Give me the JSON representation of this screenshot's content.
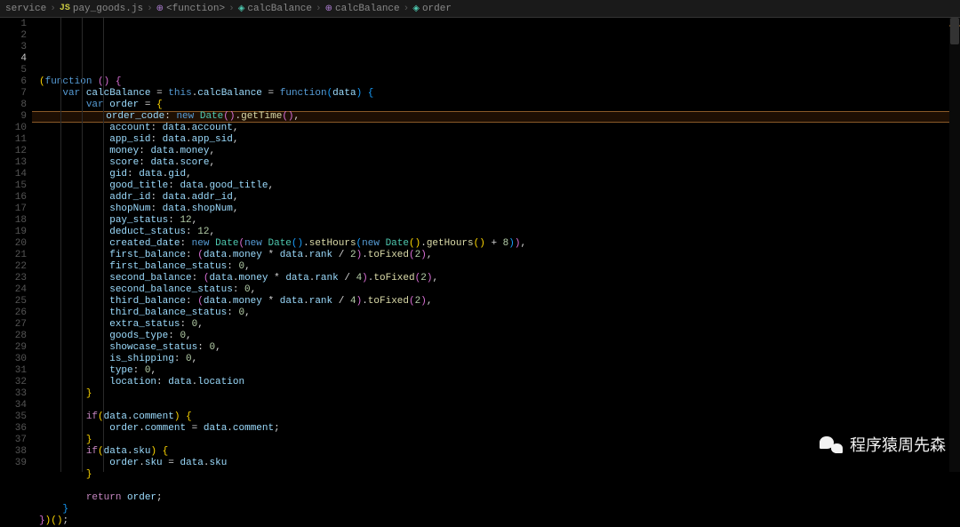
{
  "breadcrumb": {
    "items": [
      {
        "label": "service",
        "icon": ""
      },
      {
        "label": "pay_goods.js",
        "icon": "JS"
      },
      {
        "label": "<function>",
        "icon": "fn"
      },
      {
        "label": "calcBalance",
        "icon": "fld"
      },
      {
        "label": "calcBalance",
        "icon": "fn"
      },
      {
        "label": "order",
        "icon": "fld"
      }
    ]
  },
  "highlighted_line": 4,
  "code_lines": [
    {
      "n": 1,
      "html": "<span class='tk-br'>(</span><span class='tk-kw'>function</span> <span class='tk-br2'>(</span><span class='tk-br2'>)</span> <span class='tk-br2'>{</span>"
    },
    {
      "n": 2,
      "html": "    <span class='tk-kw'>var</span> <span class='tk-var'>calcBalance</span> <span class='tk-op'>=</span> <span class='tk-kw'>this</span>.<span class='tk-var'>calcBalance</span> <span class='tk-op'>=</span> <span class='tk-kw'>function</span><span class='tk-br3'>(</span><span class='tk-var'>data</span><span class='tk-br3'>)</span> <span class='tk-br3'>{</span>"
    },
    {
      "n": 3,
      "html": "        <span class='tk-kw'>var</span> <span class='tk-var'>order</span> <span class='tk-op'>=</span> <span class='tk-br'>{</span>"
    },
    {
      "n": 4,
      "html": "            <span class='tk-prop'>order_code</span>: <span class='tk-kw'>new</span> <span class='tk-cls'>Date</span><span class='tk-br2'>(</span><span class='tk-br2'>)</span>.<span class='tk-fn'>getTime</span><span class='tk-br2'>(</span><span class='tk-br2'>)</span>,"
    },
    {
      "n": 5,
      "html": "            <span class='tk-prop'>account</span>: <span class='tk-var'>data</span>.<span class='tk-var'>account</span>,"
    },
    {
      "n": 6,
      "html": "            <span class='tk-prop'>app_sid</span>: <span class='tk-var'>data</span>.<span class='tk-var'>app_sid</span>,"
    },
    {
      "n": 7,
      "html": "            <span class='tk-prop'>money</span>: <span class='tk-var'>data</span>.<span class='tk-var'>money</span>,"
    },
    {
      "n": 8,
      "html": "            <span class='tk-prop'>score</span>: <span class='tk-var'>data</span>.<span class='tk-var'>score</span>,"
    },
    {
      "n": 9,
      "html": "            <span class='tk-prop'>gid</span>: <span class='tk-var'>data</span>.<span class='tk-var'>gid</span>,"
    },
    {
      "n": 10,
      "html": "            <span class='tk-prop'>good_title</span>: <span class='tk-var'>data</span>.<span class='tk-var'>good_title</span>,"
    },
    {
      "n": 11,
      "html": "            <span class='tk-prop'>addr_id</span>: <span class='tk-var'>data</span>.<span class='tk-var'>addr_id</span>,"
    },
    {
      "n": 12,
      "html": "            <span class='tk-prop'>shopNum</span>: <span class='tk-var'>data</span>.<span class='tk-var'>shopNum</span>,"
    },
    {
      "n": 13,
      "html": "            <span class='tk-prop'>pay_status</span>: <span class='tk-num'>12</span>,"
    },
    {
      "n": 14,
      "html": "            <span class='tk-prop'>deduct_status</span>: <span class='tk-num'>12</span>,"
    },
    {
      "n": 15,
      "html": "            <span class='tk-prop'>created_date</span>: <span class='tk-kw'>new</span> <span class='tk-cls'>Date</span><span class='tk-br2'>(</span><span class='tk-kw'>new</span> <span class='tk-cls'>Date</span><span class='tk-br3'>(</span><span class='tk-br3'>)</span>.<span class='tk-fn'>setHours</span><span class='tk-br3'>(</span><span class='tk-kw'>new</span> <span class='tk-cls'>Date</span><span class='tk-br'>(</span><span class='tk-br'>)</span>.<span class='tk-fn'>getHours</span><span class='tk-br'>(</span><span class='tk-br'>)</span> <span class='tk-op'>+</span> <span class='tk-num'>8</span><span class='tk-br3'>)</span><span class='tk-br2'>)</span>,"
    },
    {
      "n": 16,
      "html": "            <span class='tk-prop'>first_balance</span>: <span class='tk-br2'>(</span><span class='tk-var'>data</span>.<span class='tk-var'>money</span> <span class='tk-op'>*</span> <span class='tk-var'>data</span>.<span class='tk-var'>rank</span> <span class='tk-op'>/</span> <span class='tk-num'>2</span><span class='tk-br2'>)</span>.<span class='tk-fn'>toFixed</span><span class='tk-br2'>(</span><span class='tk-num'>2</span><span class='tk-br2'>)</span>,"
    },
    {
      "n": 17,
      "html": "            <span class='tk-prop'>first_balance_status</span>: <span class='tk-num'>0</span>,"
    },
    {
      "n": 18,
      "html": "            <span class='tk-prop'>second_balance</span>: <span class='tk-br2'>(</span><span class='tk-var'>data</span>.<span class='tk-var'>money</span> <span class='tk-op'>*</span> <span class='tk-var'>data</span>.<span class='tk-var'>rank</span> <span class='tk-op'>/</span> <span class='tk-num'>4</span><span class='tk-br2'>)</span>.<span class='tk-fn'>toFixed</span><span class='tk-br2'>(</span><span class='tk-num'>2</span><span class='tk-br2'>)</span>,"
    },
    {
      "n": 19,
      "html": "            <span class='tk-prop'>second_balance_status</span>: <span class='tk-num'>0</span>,"
    },
    {
      "n": 20,
      "html": "            <span class='tk-prop'>third_balance</span>: <span class='tk-br2'>(</span><span class='tk-var'>data</span>.<span class='tk-var'>money</span> <span class='tk-op'>*</span> <span class='tk-var'>data</span>.<span class='tk-var'>rank</span> <span class='tk-op'>/</span> <span class='tk-num'>4</span><span class='tk-br2'>)</span>.<span class='tk-fn'>toFixed</span><span class='tk-br2'>(</span><span class='tk-num'>2</span><span class='tk-br2'>)</span>,"
    },
    {
      "n": 21,
      "html": "            <span class='tk-prop'>third_balance_status</span>: <span class='tk-num'>0</span>,"
    },
    {
      "n": 22,
      "html": "            <span class='tk-prop'>extra_status</span>: <span class='tk-num'>0</span>,"
    },
    {
      "n": 23,
      "html": "            <span class='tk-prop'>goods_type</span>: <span class='tk-num'>0</span>,"
    },
    {
      "n": 24,
      "html": "            <span class='tk-prop'>showcase_status</span>: <span class='tk-num'>0</span>,"
    },
    {
      "n": 25,
      "html": "            <span class='tk-prop'>is_shipping</span>: <span class='tk-num'>0</span>,"
    },
    {
      "n": 26,
      "html": "            <span class='tk-prop'>type</span>: <span class='tk-num'>0</span>,"
    },
    {
      "n": 27,
      "html": "            <span class='tk-prop'>location</span>: <span class='tk-var'>data</span>.<span class='tk-var'>location</span>"
    },
    {
      "n": 28,
      "html": "        <span class='tk-br'>}</span>"
    },
    {
      "n": 29,
      "html": ""
    },
    {
      "n": 30,
      "html": "        <span class='tk-kw2'>if</span><span class='tk-br'>(</span><span class='tk-var'>data</span>.<span class='tk-var'>comment</span><span class='tk-br'>)</span> <span class='tk-br'>{</span>"
    },
    {
      "n": 31,
      "html": "            <span class='tk-var'>order</span>.<span class='tk-var'>comment</span> <span class='tk-op'>=</span> <span class='tk-var'>data</span>.<span class='tk-var'>comment</span>;"
    },
    {
      "n": 32,
      "html": "        <span class='tk-br'>}</span>"
    },
    {
      "n": 33,
      "html": "        <span class='tk-kw2'>if</span><span class='tk-br'>(</span><span class='tk-var'>data</span>.<span class='tk-var'>sku</span><span class='tk-br'>)</span> <span class='tk-br'>{</span>"
    },
    {
      "n": 34,
      "html": "            <span class='tk-var'>order</span>.<span class='tk-var'>sku</span> <span class='tk-op'>=</span> <span class='tk-var'>data</span>.<span class='tk-var'>sku</span>"
    },
    {
      "n": 35,
      "html": "        <span class='tk-br'>}</span>"
    },
    {
      "n": 36,
      "html": ""
    },
    {
      "n": 37,
      "html": "        <span class='tk-kw2'>return</span> <span class='tk-var'>order</span>;"
    },
    {
      "n": 38,
      "html": "    <span class='tk-br3'>}</span>"
    },
    {
      "n": 39,
      "html": "<span class='tk-br2'>}</span><span class='tk-br'>)</span><span class='tk-br'>(</span><span class='tk-br'>)</span>;"
    }
  ],
  "watermark": {
    "text": "程序猿周先森"
  }
}
